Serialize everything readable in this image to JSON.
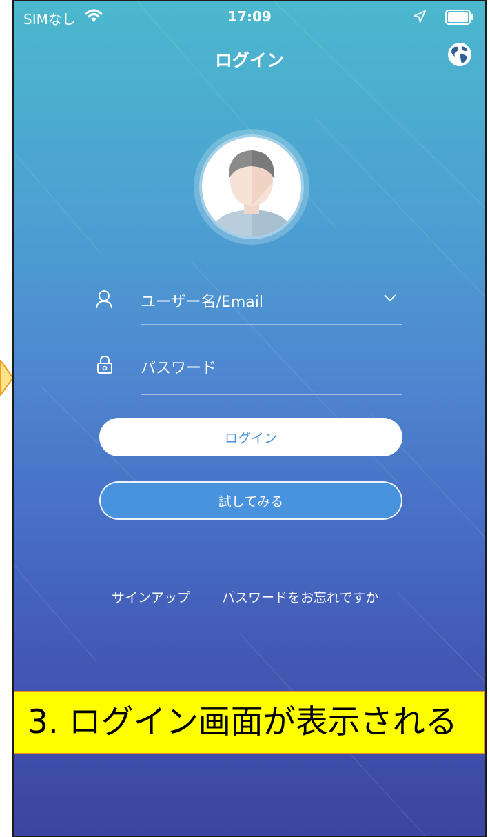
{
  "status_bar": {
    "carrier": "SIMなし",
    "time": "17:09"
  },
  "nav": {
    "title": "ログイン"
  },
  "form": {
    "username_placeholder": "ユーザー名/Email",
    "password_placeholder": "パスワード"
  },
  "buttons": {
    "login_label": "ログイン",
    "try_label": "試してみる"
  },
  "links": {
    "signup": "サインアップ",
    "forgot_password": "パスワードをお忘れですか"
  },
  "annotation": {
    "caption": "3. ログイン画面が表示される"
  },
  "colors": {
    "gradient_top": "#4cb8ce",
    "gradient_bottom": "#3c45a2",
    "login_text": "#4d93d6",
    "try_button_fill": "#4992dd",
    "annotation_fill": "#ffff00",
    "annotation_border": "#ec8a2a"
  },
  "icons": [
    "wifi-icon",
    "location-arrow-icon",
    "battery-icon",
    "globe-icon",
    "avatar-icon",
    "user-icon",
    "lock-icon",
    "chevron-down-icon",
    "arrow-hint-icon"
  ]
}
